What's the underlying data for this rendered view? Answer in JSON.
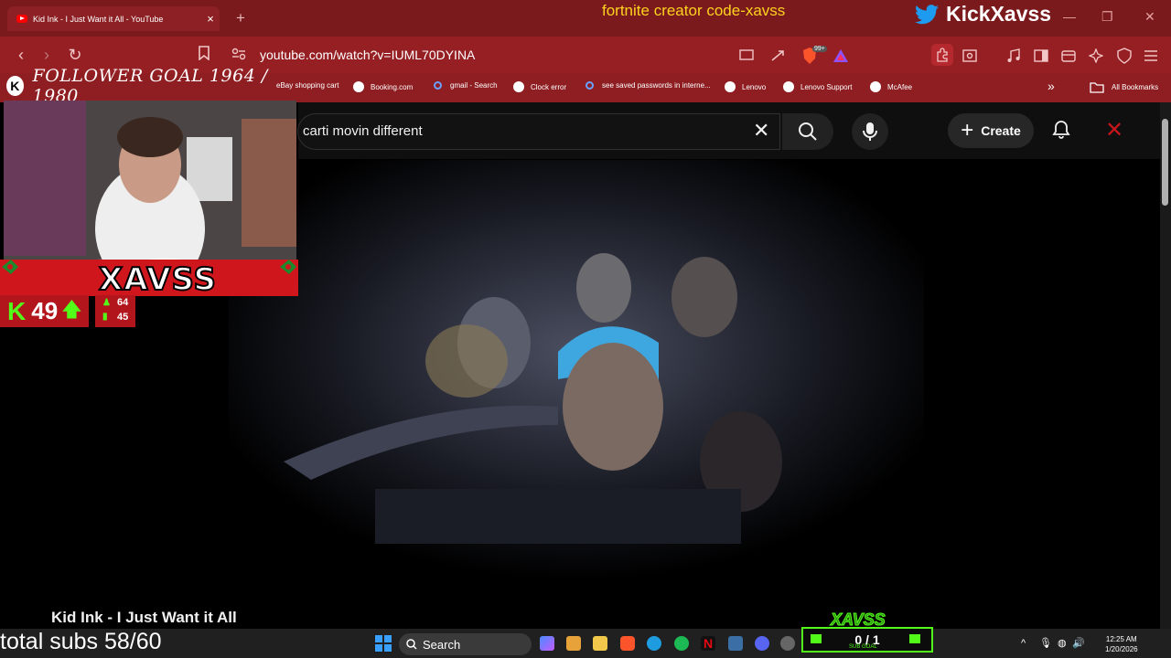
{
  "browser": {
    "tab_title": "Kid Ink - I Just Want it All - YouTube",
    "url": "youtube.com/watch?v=IUML70DYINA",
    "extension_badge": "99+",
    "bookmarks": [
      {
        "label": "eBay shopping cart"
      },
      {
        "label": "Booking.com"
      },
      {
        "label": "gmail - Search"
      },
      {
        "label": "Clock error"
      },
      {
        "label": "see saved passwords in interne..."
      },
      {
        "label": "Lenovo"
      },
      {
        "label": "Lenovo Support"
      },
      {
        "label": "McAfee"
      }
    ],
    "all_bookmarks": "All Bookmarks"
  },
  "overlay": {
    "creator_code": "fortnite creator code-xavss",
    "twitter_handle": "KickXavss",
    "follower_goal": "FOLLOWER GOAL 1964 / 1980",
    "streamer_name": "XAVSS",
    "viewer_count": "49",
    "stat_top": "64",
    "stat_bottom": "45",
    "subs_total": "total subs 58/60",
    "sub_goal_brand": "XAVSS",
    "sub_goal_value": "0 / 1",
    "sub_goal_label": "SUB GOAL"
  },
  "youtube": {
    "search_query": "carti movin different",
    "create_label": "Create",
    "video_title": "Kid Ink - I Just Want it All"
  },
  "taskbar": {
    "search_label": "Search",
    "time": "12:25 AM",
    "date": "1/20/2026"
  },
  "colors": {
    "browser_frame": "#7a1a1d",
    "kick_green": "#53fc18",
    "creator_code_yellow": "#ffd21e"
  }
}
